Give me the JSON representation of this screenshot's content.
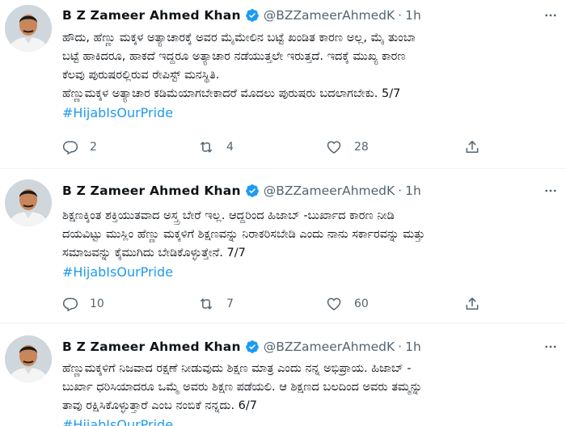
{
  "tweets": [
    {
      "name": "B Z Zameer Ahmed Khan",
      "handle": "@BZZameerAhmedK",
      "separator": "·",
      "time": "1h",
      "lines": [
        "ಹೌದು, ಹೆಣ್ಣು ಮಕ್ಕಳ ಅತ್ಯಾಚಾರಕ್ಕೆ ಅವರ ಮೈಮೇಲಿನ ಬಟ್ಟೆ ಖಂಡಿತ ಕಾರಣ ಅಲ್ಲ, ಮೈ ತುಂಬಾ",
        "ಬಟ್ಟೆ ಹಾಕಿದರೂ, ಹಾಕದೆ ಇದ್ದರೂ ಅತ್ಯಾಚಾರ ನಡೆಯುತ್ತಲೇ ಇರುತ್ತದೆ. ಇದಕ್ಕೆ ಮುಖ್ಯ ಕಾರಣ",
        "ಕೆಲವು ಪುರುಷರಲ್ಲಿರುವ ರೇಪಿಸ್ಟ್ ಮನಸ್ಥಿತಿ.",
        "ಹೆಣ್ಣುಮಕ್ಕಳ ಅತ್ಯಾಚಾರ ಕಡಿಮೆಯಾಗಬೇಕಾದರೆ ಮೊದಲು ಪುರುಷರು ಬದಲಾಗಬೇಕು. 5/7"
      ],
      "hashtag": "#HijabIsOurPride",
      "replies": "2",
      "retweets": "4",
      "likes": "28"
    },
    {
      "name": "B Z Zameer Ahmed Khan",
      "handle": "@BZZameerAhmedK",
      "separator": "·",
      "time": "1h",
      "lines": [
        "ಶಿಕ್ಷಣಕ್ಕಿಂತ ಶಕ್ತಿಯುತವಾದ ಅಸ್ತ್ರ ಬೇರೆ ಇಲ್ಲ. ಆದ್ದರಿಂದ ಹಿಜಾಬ್ -ಬುರ್ಖಾದ ಕಾರಣ ನೀಡಿ",
        "ದಯವಿಟ್ಟು ಮುಸ್ಲಿಂ ಹೆಣ್ಣು ಮಕ್ಕಳಿಗೆ ಶಿಕ್ಷಣವನ್ನು ನಿರಾಕರಿಸಬೇಡಿ ಎಂದು ನಾನು ಸರ್ಕಾರವನ್ನು ಮತ್ತು",
        "ಸಮಾಜವನ್ನು ಕೈಮುಗಿದು ಬೇಡಿಕೊಳ್ಳುತ್ತೇನೆ. 7/7"
      ],
      "hashtag": "#HijabIsOurPride",
      "replies": "10",
      "retweets": "7",
      "likes": "60"
    },
    {
      "name": "B Z Zameer Ahmed Khan",
      "handle": "@BZZameerAhmedK",
      "separator": "·",
      "time": "1h",
      "lines": [
        "ಹೆಣ್ಣುಮಕ್ಕಳಿಗೆ ನಿಜವಾದ ರಕ್ಷಣೆ ನೀಡುವುದು ಶಿಕ್ಷಣ ಮಾತ್ರ ಎಂದು ನನ್ನ ಅಭಿಪ್ರಾಯ. ಹಿಜಾಬ್ -",
        "ಬುರ್ಖಾ ಧರಿಸಿಯಾದರೂ ಒಮ್ಮೆ ಅವರು ಶಿಕ್ಷಣ ಪಡೆಯಲಿ. ಆ ಶಿಕ್ಷಣದ ಬಲದಿಂದ ಅವರು ತಮ್ಮನ್ನು",
        "ತಾವು ರಕ್ಷಿಸಿಕೊಳ್ಳುತ್ತಾರೆ ಎಂಬ ನಂಬಿಕೆ ನನ್ನದು. 6/7"
      ],
      "hashtag": "#HijabIsOurPride",
      "replies": "",
      "retweets": "",
      "likes": ""
    }
  ],
  "colors": {
    "text": "#0f1419",
    "secondary": "#536471",
    "link": "#1d9bf0",
    "verified": "#1d9bf0",
    "divider": "#eff3f4"
  },
  "icons": [
    "avatar",
    "verified-badge-icon",
    "more-options-icon",
    "reply-icon",
    "retweet-icon",
    "like-icon",
    "share-icon"
  ]
}
